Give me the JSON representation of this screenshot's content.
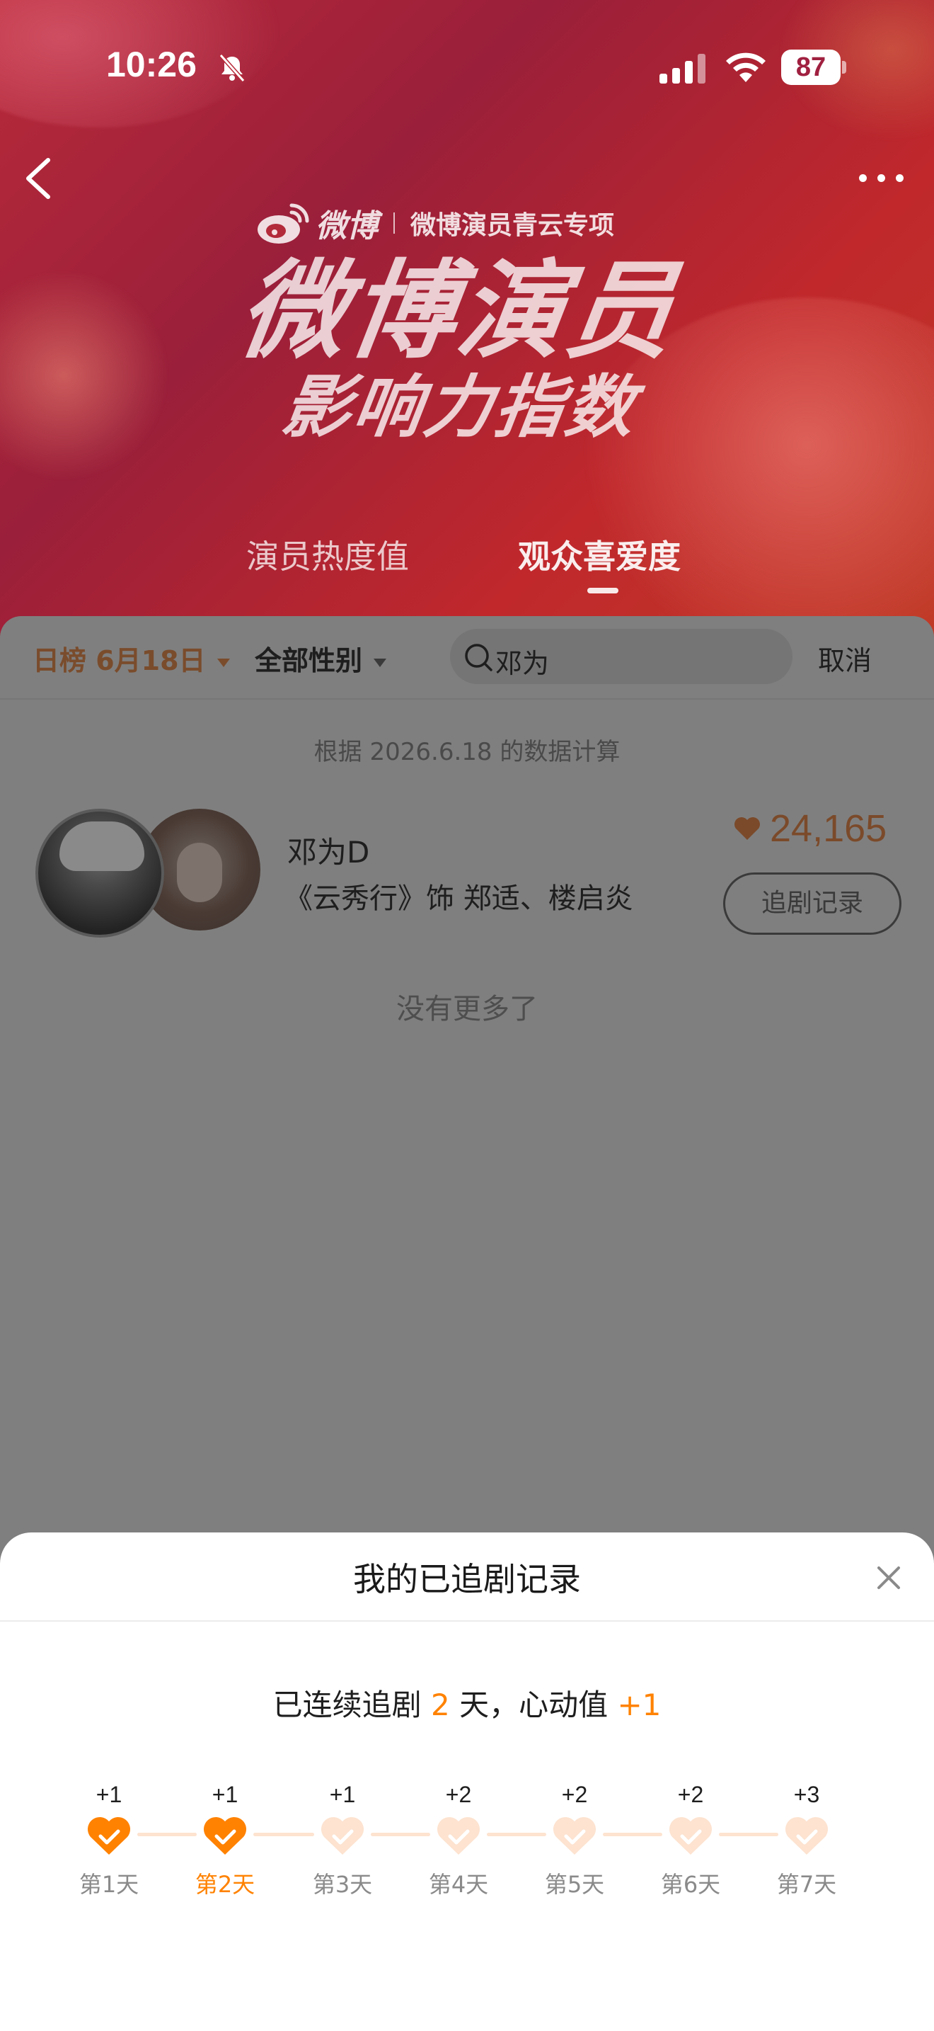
{
  "status_bar": {
    "time": "10:26",
    "battery": "87"
  },
  "banner": {
    "brand_name": "微博",
    "brand_sub": "微博演员青云专项",
    "title_line1": "微博演员",
    "title_line2": "影响力指数",
    "tabs": [
      {
        "label": "演员热度值",
        "active": false
      },
      {
        "label": "观众喜爱度",
        "active": true
      }
    ]
  },
  "filters": {
    "date_label": "日榜 6月18日",
    "gender_label": "全部性别",
    "search_value": "邓为",
    "cancel_label": "取消"
  },
  "data_note": "根据 2026.6.18 的数据计算",
  "result": {
    "name": "邓为D",
    "role": "《云秀行》饰 郑适、楼启炎",
    "score": "24,165",
    "track_button": "追剧记录"
  },
  "no_more": "没有更多了",
  "modal": {
    "title": "我的已追剧记录",
    "streak_prefix": "已连续追剧",
    "streak_days": "2",
    "streak_mid": "天，心动值",
    "streak_value": "+1",
    "days": [
      {
        "bonus": "+1",
        "label": "第1天",
        "checked": true,
        "active": false
      },
      {
        "bonus": "+1",
        "label": "第2天",
        "checked": true,
        "active": true
      },
      {
        "bonus": "+1",
        "label": "第3天",
        "checked": false,
        "active": false
      },
      {
        "bonus": "+2",
        "label": "第4天",
        "checked": false,
        "active": false
      },
      {
        "bonus": "+2",
        "label": "第5天",
        "checked": false,
        "active": false
      },
      {
        "bonus": "+2",
        "label": "第6天",
        "checked": false,
        "active": false
      },
      {
        "bonus": "+3",
        "label": "第7天",
        "checked": false,
        "active": false
      }
    ]
  },
  "colors": {
    "accent": "#ff8200",
    "heart_unchecked": "#fde3d0",
    "banner_red": "#b82a3a"
  }
}
